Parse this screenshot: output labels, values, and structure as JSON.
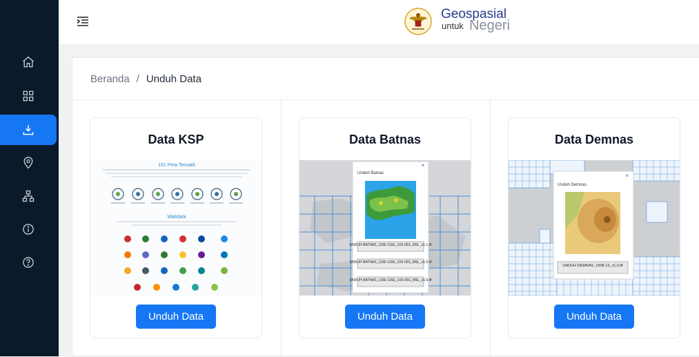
{
  "sidebar": {
    "items": [
      {
        "name": "home-icon",
        "active": false
      },
      {
        "name": "grid-icon",
        "active": false
      },
      {
        "name": "download-icon",
        "active": true
      },
      {
        "name": "map-pin-icon",
        "active": false
      },
      {
        "name": "sitemap-icon",
        "active": false
      },
      {
        "name": "info-icon",
        "active": false
      },
      {
        "name": "help-icon",
        "active": false
      }
    ]
  },
  "header": {
    "logo_title": "Geospasial",
    "logo_untuk": "untuk",
    "logo_negeri": "Negeri"
  },
  "breadcrumb": {
    "home": "Beranda",
    "separator": "/",
    "current": "Unduh Data"
  },
  "cards": [
    {
      "title": "Data KSP",
      "button": "Unduh Data",
      "preview": {
        "heading": "151 Peta Tematik",
        "section": "Walidata"
      }
    },
    {
      "title": "Data Batnas",
      "button": "Unduh Data",
      "preview": {
        "popup_title": "Unduh Batnas",
        "files": [
          "UNDUH BATNAS_110E-115E_10S-05S_MSL_v1.1.tif",
          "UNDUH BATNAS_110E-115E_10S-05S_MSL_v1.5.tif",
          "UNDUH BATNAS_110E-115E_10S-05S_MSL_v1.6.tif"
        ]
      }
    },
    {
      "title": "Data Demnas",
      "button": "Unduh Data",
      "preview": {
        "popup_title": "Unduh Demnas",
        "files": [
          "UNDUH DEMNAS_1508-13_v1.0.tif"
        ]
      }
    }
  ],
  "colors": {
    "sidebar_bg": "#0b1a2b",
    "accent": "#1677f5",
    "logo_blue": "#2a3a8a"
  }
}
